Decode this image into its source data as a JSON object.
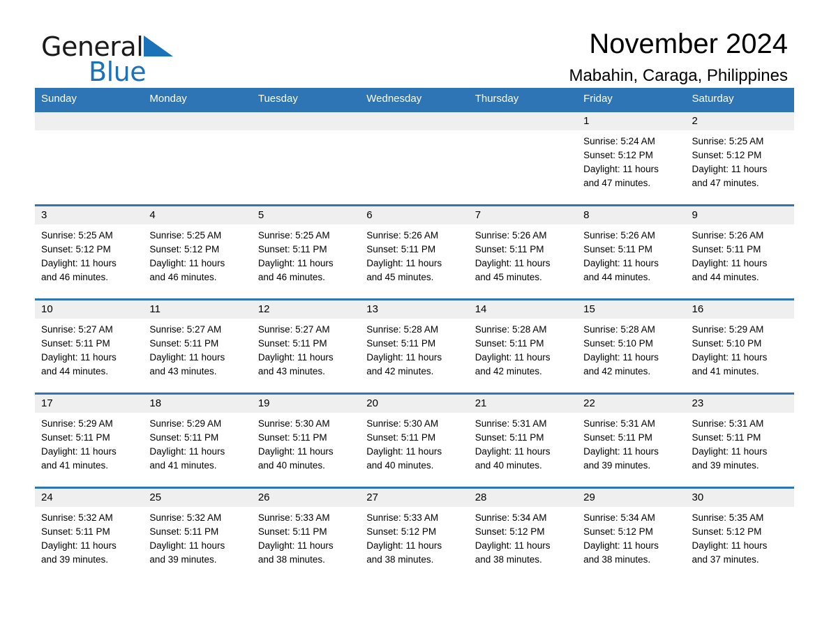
{
  "logo": {
    "word1": "General",
    "word2": "Blue",
    "triangle_color": "#1a72b8",
    "text_color": "#1a1a1a",
    "icon": "triangle-flag-icon"
  },
  "header": {
    "title": "November 2024",
    "subtitle": "Mabahin, Caraga, Philippines"
  },
  "theme": {
    "header_blue": "#2e75b6",
    "daynum_gray": "#efefef",
    "cell_white": "#ffffff",
    "text_black": "#000000"
  },
  "weekdays": [
    "Sunday",
    "Monday",
    "Tuesday",
    "Wednesday",
    "Thursday",
    "Friday",
    "Saturday"
  ],
  "weeks": [
    [
      {
        "day": "",
        "sunrise": "",
        "sunset": "",
        "daylight": "",
        "daylight2": ""
      },
      {
        "day": "",
        "sunrise": "",
        "sunset": "",
        "daylight": "",
        "daylight2": ""
      },
      {
        "day": "",
        "sunrise": "",
        "sunset": "",
        "daylight": "",
        "daylight2": ""
      },
      {
        "day": "",
        "sunrise": "",
        "sunset": "",
        "daylight": "",
        "daylight2": ""
      },
      {
        "day": "",
        "sunrise": "",
        "sunset": "",
        "daylight": "",
        "daylight2": ""
      },
      {
        "day": "1",
        "sunrise": "Sunrise: 5:24 AM",
        "sunset": "Sunset: 5:12 PM",
        "daylight": "Daylight: 11 hours",
        "daylight2": "and 47 minutes."
      },
      {
        "day": "2",
        "sunrise": "Sunrise: 5:25 AM",
        "sunset": "Sunset: 5:12 PM",
        "daylight": "Daylight: 11 hours",
        "daylight2": "and 47 minutes."
      }
    ],
    [
      {
        "day": "3",
        "sunrise": "Sunrise: 5:25 AM",
        "sunset": "Sunset: 5:12 PM",
        "daylight": "Daylight: 11 hours",
        "daylight2": "and 46 minutes."
      },
      {
        "day": "4",
        "sunrise": "Sunrise: 5:25 AM",
        "sunset": "Sunset: 5:12 PM",
        "daylight": "Daylight: 11 hours",
        "daylight2": "and 46 minutes."
      },
      {
        "day": "5",
        "sunrise": "Sunrise: 5:25 AM",
        "sunset": "Sunset: 5:11 PM",
        "daylight": "Daylight: 11 hours",
        "daylight2": "and 46 minutes."
      },
      {
        "day": "6",
        "sunrise": "Sunrise: 5:26 AM",
        "sunset": "Sunset: 5:11 PM",
        "daylight": "Daylight: 11 hours",
        "daylight2": "and 45 minutes."
      },
      {
        "day": "7",
        "sunrise": "Sunrise: 5:26 AM",
        "sunset": "Sunset: 5:11 PM",
        "daylight": "Daylight: 11 hours",
        "daylight2": "and 45 minutes."
      },
      {
        "day": "8",
        "sunrise": "Sunrise: 5:26 AM",
        "sunset": "Sunset: 5:11 PM",
        "daylight": "Daylight: 11 hours",
        "daylight2": "and 44 minutes."
      },
      {
        "day": "9",
        "sunrise": "Sunrise: 5:26 AM",
        "sunset": "Sunset: 5:11 PM",
        "daylight": "Daylight: 11 hours",
        "daylight2": "and 44 minutes."
      }
    ],
    [
      {
        "day": "10",
        "sunrise": "Sunrise: 5:27 AM",
        "sunset": "Sunset: 5:11 PM",
        "daylight": "Daylight: 11 hours",
        "daylight2": "and 44 minutes."
      },
      {
        "day": "11",
        "sunrise": "Sunrise: 5:27 AM",
        "sunset": "Sunset: 5:11 PM",
        "daylight": "Daylight: 11 hours",
        "daylight2": "and 43 minutes."
      },
      {
        "day": "12",
        "sunrise": "Sunrise: 5:27 AM",
        "sunset": "Sunset: 5:11 PM",
        "daylight": "Daylight: 11 hours",
        "daylight2": "and 43 minutes."
      },
      {
        "day": "13",
        "sunrise": "Sunrise: 5:28 AM",
        "sunset": "Sunset: 5:11 PM",
        "daylight": "Daylight: 11 hours",
        "daylight2": "and 42 minutes."
      },
      {
        "day": "14",
        "sunrise": "Sunrise: 5:28 AM",
        "sunset": "Sunset: 5:11 PM",
        "daylight": "Daylight: 11 hours",
        "daylight2": "and 42 minutes."
      },
      {
        "day": "15",
        "sunrise": "Sunrise: 5:28 AM",
        "sunset": "Sunset: 5:10 PM",
        "daylight": "Daylight: 11 hours",
        "daylight2": "and 42 minutes."
      },
      {
        "day": "16",
        "sunrise": "Sunrise: 5:29 AM",
        "sunset": "Sunset: 5:10 PM",
        "daylight": "Daylight: 11 hours",
        "daylight2": "and 41 minutes."
      }
    ],
    [
      {
        "day": "17",
        "sunrise": "Sunrise: 5:29 AM",
        "sunset": "Sunset: 5:11 PM",
        "daylight": "Daylight: 11 hours",
        "daylight2": "and 41 minutes."
      },
      {
        "day": "18",
        "sunrise": "Sunrise: 5:29 AM",
        "sunset": "Sunset: 5:11 PM",
        "daylight": "Daylight: 11 hours",
        "daylight2": "and 41 minutes."
      },
      {
        "day": "19",
        "sunrise": "Sunrise: 5:30 AM",
        "sunset": "Sunset: 5:11 PM",
        "daylight": "Daylight: 11 hours",
        "daylight2": "and 40 minutes."
      },
      {
        "day": "20",
        "sunrise": "Sunrise: 5:30 AM",
        "sunset": "Sunset: 5:11 PM",
        "daylight": "Daylight: 11 hours",
        "daylight2": "and 40 minutes."
      },
      {
        "day": "21",
        "sunrise": "Sunrise: 5:31 AM",
        "sunset": "Sunset: 5:11 PM",
        "daylight": "Daylight: 11 hours",
        "daylight2": "and 40 minutes."
      },
      {
        "day": "22",
        "sunrise": "Sunrise: 5:31 AM",
        "sunset": "Sunset: 5:11 PM",
        "daylight": "Daylight: 11 hours",
        "daylight2": "and 39 minutes."
      },
      {
        "day": "23",
        "sunrise": "Sunrise: 5:31 AM",
        "sunset": "Sunset: 5:11 PM",
        "daylight": "Daylight: 11 hours",
        "daylight2": "and 39 minutes."
      }
    ],
    [
      {
        "day": "24",
        "sunrise": "Sunrise: 5:32 AM",
        "sunset": "Sunset: 5:11 PM",
        "daylight": "Daylight: 11 hours",
        "daylight2": "and 39 minutes."
      },
      {
        "day": "25",
        "sunrise": "Sunrise: 5:32 AM",
        "sunset": "Sunset: 5:11 PM",
        "daylight": "Daylight: 11 hours",
        "daylight2": "and 39 minutes."
      },
      {
        "day": "26",
        "sunrise": "Sunrise: 5:33 AM",
        "sunset": "Sunset: 5:11 PM",
        "daylight": "Daylight: 11 hours",
        "daylight2": "and 38 minutes."
      },
      {
        "day": "27",
        "sunrise": "Sunrise: 5:33 AM",
        "sunset": "Sunset: 5:12 PM",
        "daylight": "Daylight: 11 hours",
        "daylight2": "and 38 minutes."
      },
      {
        "day": "28",
        "sunrise": "Sunrise: 5:34 AM",
        "sunset": "Sunset: 5:12 PM",
        "daylight": "Daylight: 11 hours",
        "daylight2": "and 38 minutes."
      },
      {
        "day": "29",
        "sunrise": "Sunrise: 5:34 AM",
        "sunset": "Sunset: 5:12 PM",
        "daylight": "Daylight: 11 hours",
        "daylight2": "and 38 minutes."
      },
      {
        "day": "30",
        "sunrise": "Sunrise: 5:35 AM",
        "sunset": "Sunset: 5:12 PM",
        "daylight": "Daylight: 11 hours",
        "daylight2": "and 37 minutes."
      }
    ]
  ]
}
